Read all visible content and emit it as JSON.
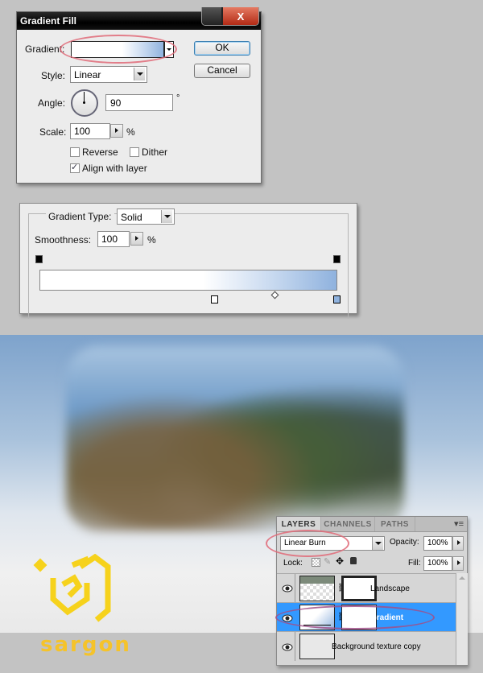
{
  "gradient_fill_dialog": {
    "title": "Gradient Fill",
    "close_glyph": "X",
    "gradient_label": "Gradient:",
    "style_label": "Style:",
    "style_value": "Linear",
    "angle_label": "Angle:",
    "angle_value": "90",
    "angle_unit": "°",
    "scale_label": "Scale:",
    "scale_value": "100",
    "scale_unit": "%",
    "reverse_label": "Reverse",
    "reverse_checked": false,
    "dither_label": "Dither",
    "dither_checked": false,
    "align_label": "Align with layer",
    "align_checked": true,
    "ok_label": "OK",
    "cancel_label": "Cancel"
  },
  "gradient_editor": {
    "type_label": "Gradient Type:",
    "type_value": "Solid",
    "smoothness_label": "Smoothness:",
    "smoothness_value": "100",
    "smoothness_unit": "%",
    "opacity_stops_percent": [
      0,
      100
    ],
    "color_stops": [
      {
        "location_percent": 59,
        "color": "#ffffff"
      },
      {
        "location_percent": 100,
        "color": "#8fb2de"
      }
    ],
    "midpoint_percent": 79
  },
  "layers_panel": {
    "tabs": [
      "LAYERS",
      "CHANNELS",
      "PATHS"
    ],
    "active_tab": "LAYERS",
    "blend_mode": "Linear Burn",
    "opacity_label": "Opacity:",
    "opacity_value": "100%",
    "lock_label": "Lock:",
    "fill_label": "Fill:",
    "fill_value": "100%",
    "layers": [
      {
        "name": "Landscape",
        "visible": true,
        "selected": false
      },
      {
        "name": "Gradient",
        "visible": true,
        "selected": true
      },
      {
        "name": "Background texture copy",
        "visible": true,
        "selected": false
      }
    ]
  },
  "watermark": {
    "text": "sargon",
    "color": "#f5c32a"
  },
  "colors": {
    "selection": "#3399ff",
    "highlight_ring": "#e06a78",
    "gradient_end": "#8fb2de"
  }
}
